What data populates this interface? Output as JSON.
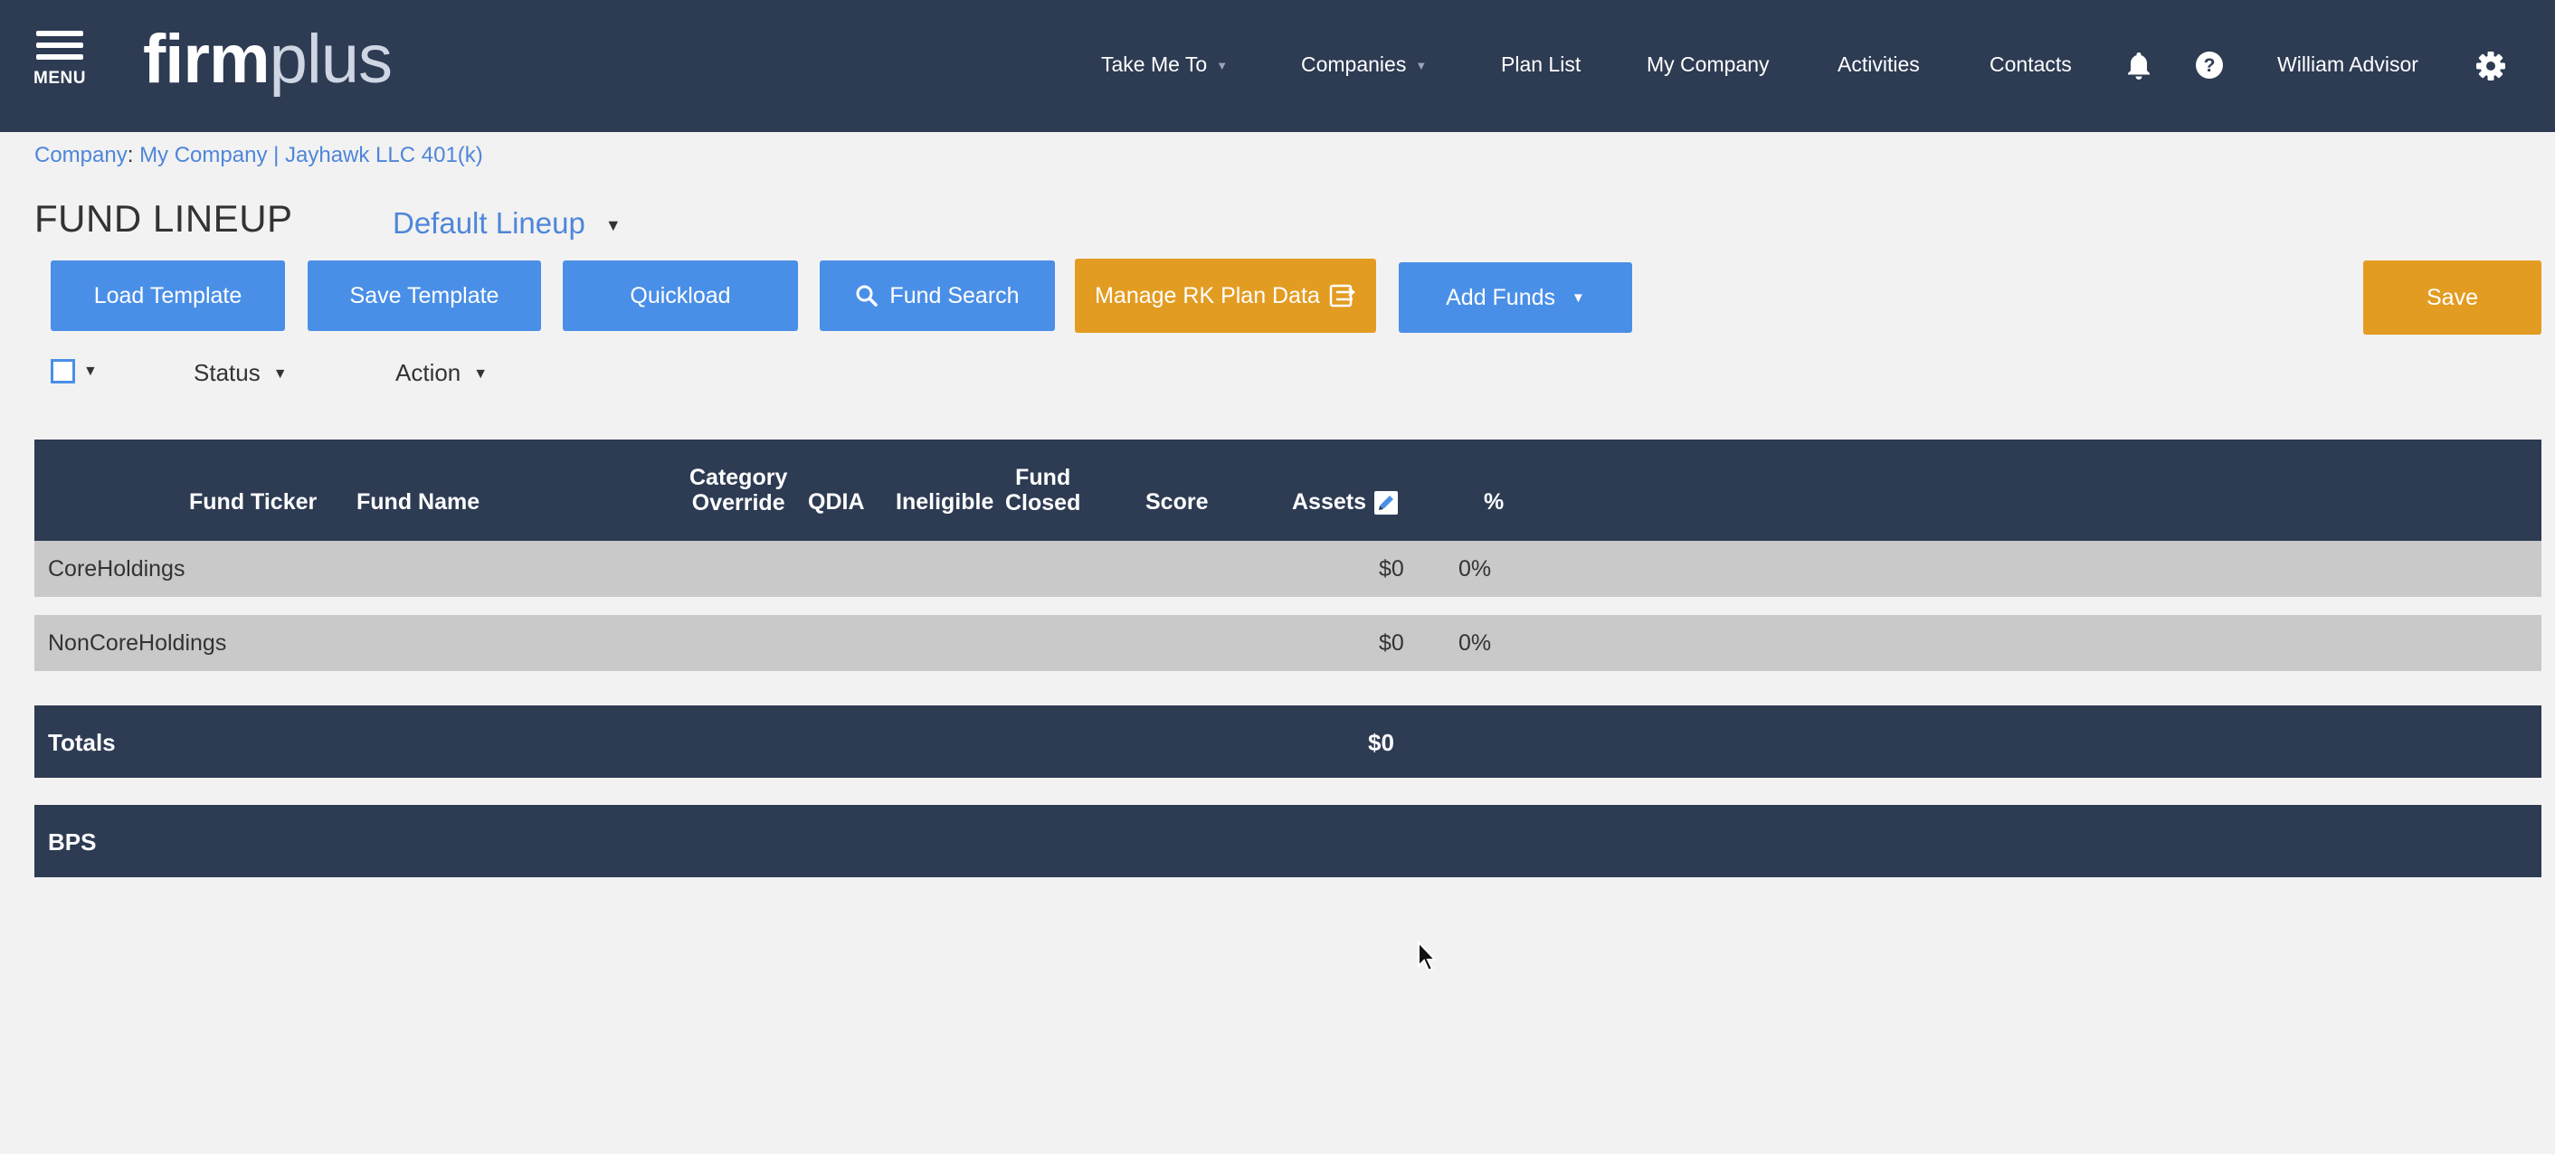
{
  "nav": {
    "menu_label": "MENU",
    "logo_firm": "firm",
    "logo_plus": "plus",
    "items": [
      "Take Me To",
      "Companies",
      "Plan List",
      "My Company",
      "Activities",
      "Contacts"
    ],
    "user": "William Advisor"
  },
  "breadcrumb": {
    "label": "Company",
    "separator": ":",
    "value": "My Company | Jayhawk LLC 401(k)"
  },
  "page": {
    "title": "FUND LINEUP",
    "lineup": "Default Lineup"
  },
  "toolbar": {
    "load_template": "Load Template",
    "save_template": "Save Template",
    "quickload": "Quickload",
    "fund_search": "Fund Search",
    "manage_rk": "Manage RK Plan Data",
    "add_funds": "Add Funds",
    "save": "Save"
  },
  "filters": {
    "status": "Status",
    "action": "Action"
  },
  "table": {
    "headers": {
      "fund_ticker": "Fund Ticker",
      "fund_name": "Fund Name",
      "category_override_1": "Category",
      "category_override_2": "Override",
      "qdia": "QDIA",
      "ineligible": "Ineligible",
      "fund_closed_1": "Fund",
      "fund_closed_2": "Closed",
      "score": "Score",
      "assets": "Assets",
      "percent": "%"
    },
    "groups": [
      {
        "name": "CoreHoldings",
        "assets": "$0",
        "percent": "0%"
      },
      {
        "name": "NonCoreHoldings",
        "assets": "$0",
        "percent": "0%"
      }
    ],
    "totals": {
      "label": "Totals",
      "assets": "$0"
    },
    "bps": {
      "label": "BPS"
    }
  },
  "colors": {
    "navy": "#2d3b53",
    "blue": "#4a8fe7",
    "orange": "#e39c22",
    "link": "#4f86d9"
  }
}
